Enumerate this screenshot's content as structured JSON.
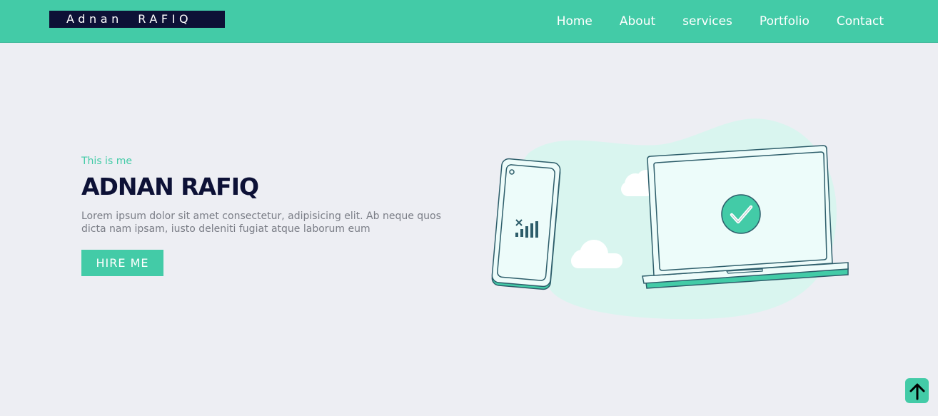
{
  "header": {
    "logo_text": "Adnan  RAFIQ",
    "nav": [
      "Home",
      "About",
      "services",
      "Portfolio",
      "Contact"
    ]
  },
  "hero": {
    "intro": "This is me",
    "name": "ADNAN RAFIQ",
    "description": "Lorem ipsum dolor sit amet consectetur, adipisicing elit. Ab neque quos dicta nam ipsam, iusto deleniti fugiat atque laborum eum",
    "button_label": "HIRE ME"
  },
  "illustration": {
    "icons": [
      "phone-icon",
      "signal-icon",
      "cloud-icon",
      "laptop-icon",
      "check-icon"
    ]
  },
  "scroll_top": {
    "icon": "arrow-up-icon"
  },
  "colors": {
    "accent": "#43cba7",
    "dark": "#0d1136",
    "background": "#edeef3",
    "text_muted": "#7a7d86"
  }
}
